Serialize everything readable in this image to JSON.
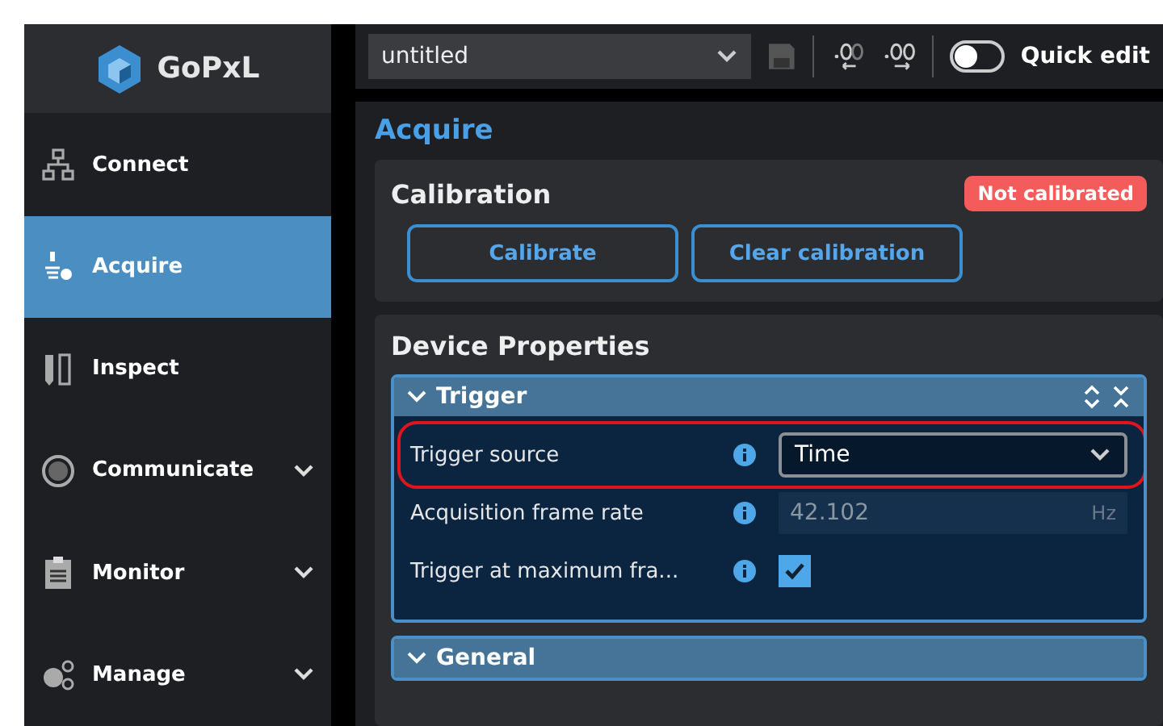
{
  "brand": {
    "name": "GoPxL"
  },
  "sidebar": {
    "items": [
      {
        "label": "Connect",
        "selected": false,
        "expandable": false
      },
      {
        "label": "Acquire",
        "selected": true,
        "expandable": false
      },
      {
        "label": "Inspect",
        "selected": false,
        "expandable": false
      },
      {
        "label": "Communicate",
        "selected": false,
        "expandable": true
      },
      {
        "label": "Monitor",
        "selected": false,
        "expandable": true
      },
      {
        "label": "Manage",
        "selected": false,
        "expandable": true
      }
    ]
  },
  "toolbar": {
    "document": "untitled",
    "quick_edit": {
      "label": "Quick edit",
      "on": false
    }
  },
  "page": {
    "title": "Acquire",
    "calibration": {
      "title": "Calibration",
      "status": "Not calibrated",
      "buttons": [
        "Calibrate",
        "Clear calibration"
      ]
    },
    "device_properties": {
      "title": "Device Properties",
      "groups": [
        {
          "title": "Trigger",
          "expanded": true,
          "rows": [
            {
              "kind": "select",
              "label": "Trigger source",
              "value": "Time",
              "highlighted": true
            },
            {
              "kind": "number",
              "label": "Acquisition frame rate",
              "value": "42.102",
              "unit": "Hz",
              "disabled": true
            },
            {
              "kind": "checkbox",
              "label": "Trigger at maximum fra...",
              "checked": true
            }
          ]
        },
        {
          "title": "General",
          "expanded": true
        }
      ]
    }
  }
}
